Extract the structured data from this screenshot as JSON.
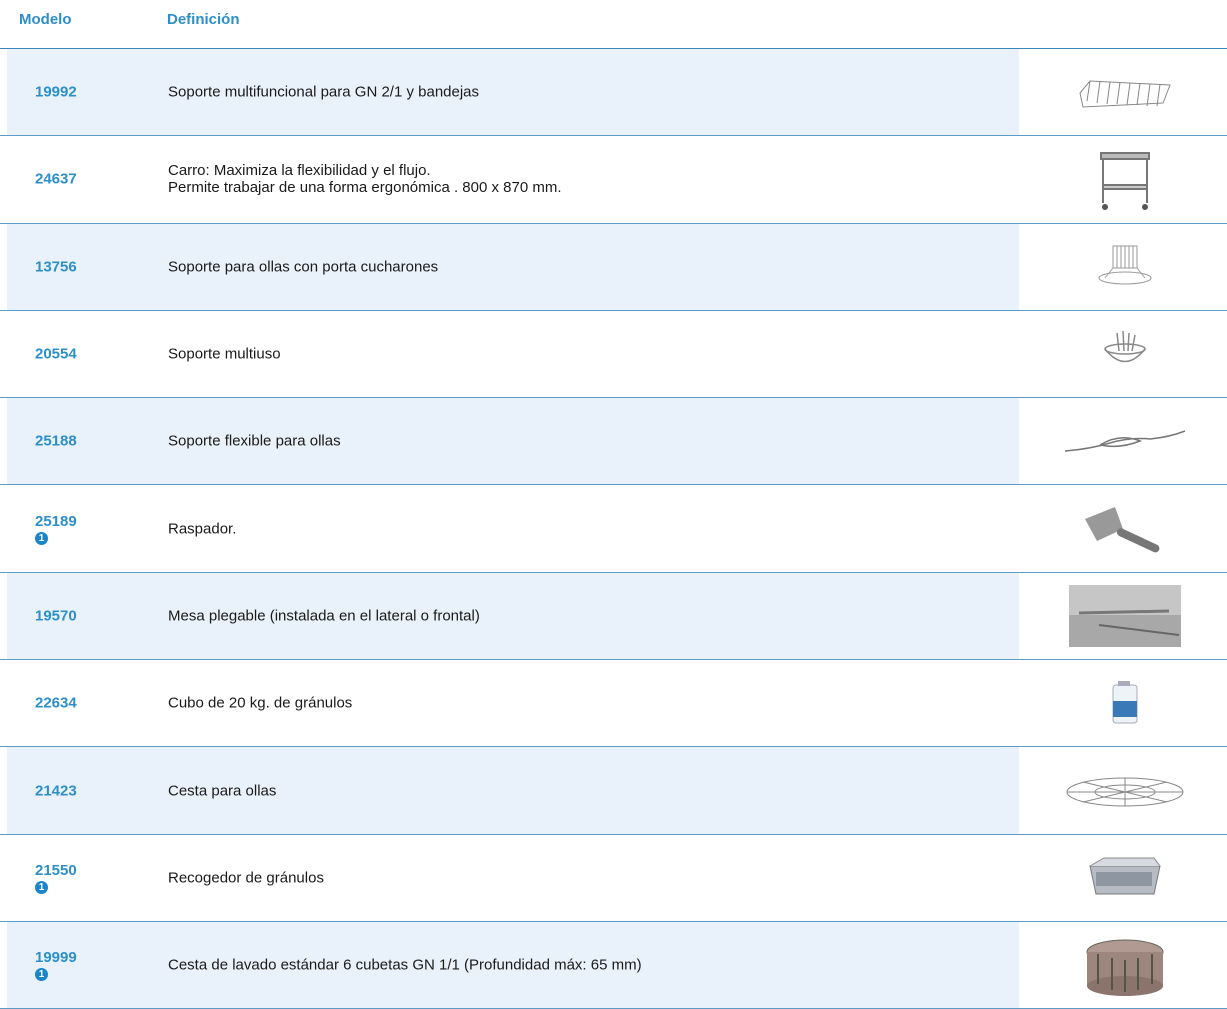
{
  "header": {
    "model_label": "Modelo",
    "definition_label": "Definición"
  },
  "rows": [
    {
      "model": "19992",
      "note": "",
      "desc": "Soporte multifuncional para GN 2/1 y bandejas",
      "image": "wire-rack-icon"
    },
    {
      "model": "24637",
      "note": "",
      "desc": "Carro: Maximiza la flexibilidad y el flujo.\nPermite trabajar de una forma ergonómica . 800 x 870 mm.",
      "image": "trolley-cart-icon"
    },
    {
      "model": "13756",
      "note": "",
      "desc": "Soporte para ollas con porta cucharones",
      "image": "pot-holder-icon"
    },
    {
      "model": "20554",
      "note": "",
      "desc": "Soporte multiuso",
      "image": "multi-holder-icon"
    },
    {
      "model": "25188",
      "note": "",
      "desc": "Soporte flexible para ollas",
      "image": "flexible-strap-icon"
    },
    {
      "model": "25189",
      "note": "1",
      "desc": "Raspador.",
      "image": "scraper-icon"
    },
    {
      "model": "19570",
      "note": "",
      "desc": "Mesa plegable (instalada en el lateral o frontal)",
      "image": "folding-table-icon"
    },
    {
      "model": "22634",
      "note": "",
      "desc": "Cubo de 20 kg. de gránulos",
      "image": "granule-bucket-icon"
    },
    {
      "model": "21423",
      "note": "",
      "desc": "Cesta para ollas",
      "image": "pot-basket-icon"
    },
    {
      "model": "21550",
      "note": "1",
      "desc": "Recogedor de gránulos",
      "image": "granule-collector-icon"
    },
    {
      "model": "19999",
      "note": "1",
      "desc": "Cesta de lavado estándar 6 cubetas GN 1/1 (Profundidad máx: 65 mm)",
      "image": "wash-basket-icon"
    }
  ]
}
